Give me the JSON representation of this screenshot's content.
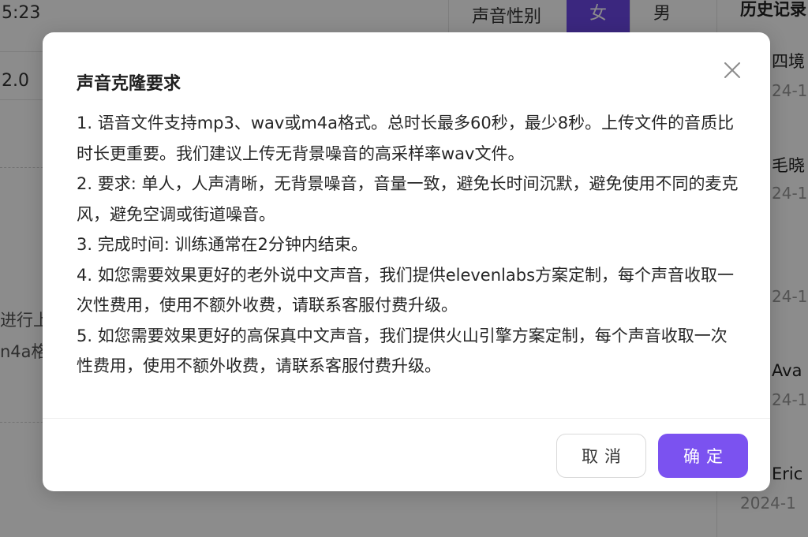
{
  "background": {
    "time_text": "5:23",
    "speed_text": "2.0",
    "hint_line1": "进行上",
    "hint_line2": "n4a格",
    "gender_label": "声音性别",
    "gender_female": "女",
    "gender_male": "男",
    "history_title": "历史记录",
    "history_items": [
      {
        "name": "四境",
        "date": "24-1"
      },
      {
        "name": "毛晓",
        "date": "24-1"
      },
      {
        "name": "",
        "date": "24-1"
      },
      {
        "name": "Ava",
        "date": "24-1"
      },
      {
        "name": "Eric",
        "date": "2024-1"
      }
    ],
    "accent_color": "#6c47e8"
  },
  "dialog": {
    "title": "声音克隆要求",
    "close_icon": "close-icon",
    "requirements": [
      "1. 语音文件支持mp3、wav或m4a格式。总时长最多60秒，最少8秒。上传文件的音质比时长更重要。我们建议上传无背景噪音的高采样率wav文件。",
      "2. 要求: 单人，人声清晰，无背景噪音，音量一致，避免长时间沉默，避免使用不同的麦克风，避免空调或街道噪音。",
      "3. 完成时间: 训练通常在2分钟内结束。",
      "4. 如您需要效果更好的老外说中文声音，我们提供elevenlabs方案定制，每个声音收取一次性费用，使用不额外收费，请联系客服付费升级。",
      "5. 如您需要效果更好的高保真中文声音，我们提供火山引擎方案定制，每个声音收取一次性费用，使用不额外收费，请联系客服付费升级。"
    ],
    "cancel_label": "取消",
    "confirm_label": "确定",
    "confirm_color": "#7b52f0"
  }
}
